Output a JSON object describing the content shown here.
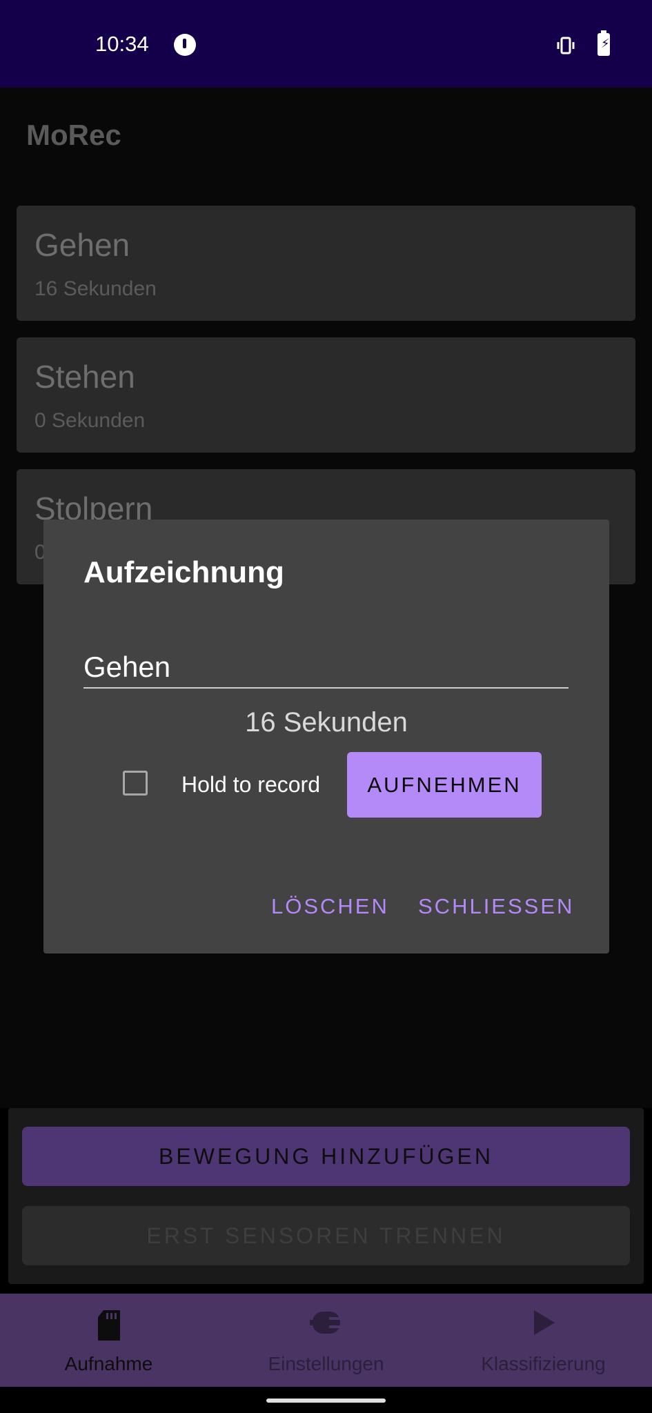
{
  "status_bar": {
    "time": "10:34"
  },
  "app": {
    "title": "MoRec"
  },
  "recordings": [
    {
      "name": "Gehen",
      "duration": "16 Sekunden"
    },
    {
      "name": "Stehen",
      "duration": "0 Sekunden"
    },
    {
      "name": "Stolpern",
      "duration": "0"
    }
  ],
  "buttons": {
    "add_motion": "BEWEGUNG HINZUFÜGEN",
    "disconnect": "ERST SENSOREN TRENNEN"
  },
  "nav": [
    {
      "label": "Aufnahme",
      "icon": "sd-card-icon"
    },
    {
      "label": "Einstellungen",
      "icon": "plug-icon"
    },
    {
      "label": "Klassifizierung",
      "icon": "play-icon"
    }
  ],
  "dialog": {
    "title": "Aufzeichnung",
    "name_value": "Gehen",
    "duration": "16 Sekunden",
    "hold_label": "Hold to record",
    "record_button": "AUFNEHMEN",
    "delete_button": "LÖSCHEN",
    "close_button": "SCHLIESSEN"
  },
  "colors": {
    "status_bar": "#14004a",
    "accent": "#b38af7",
    "nav_background": "#4a3463"
  }
}
